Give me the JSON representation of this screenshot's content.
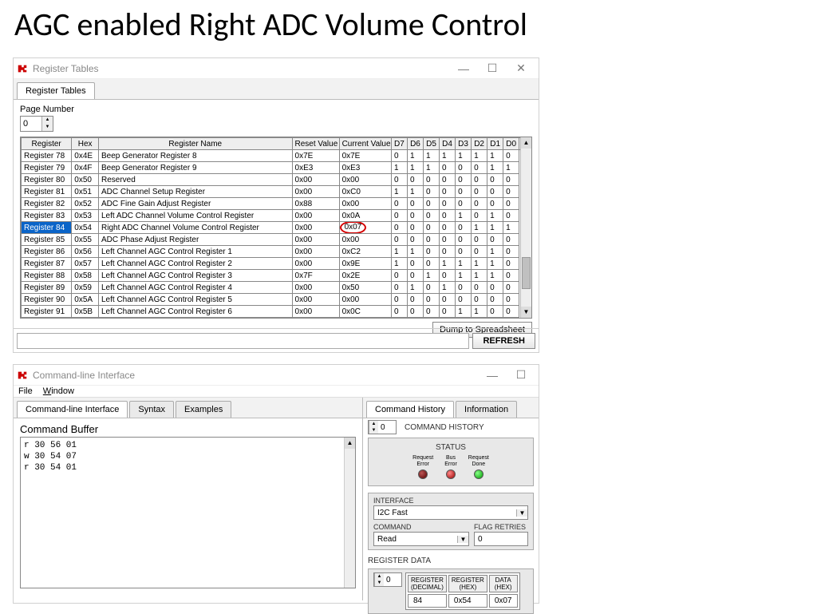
{
  "slide_title": "AGC enabled Right ADC Volume Control",
  "win1": {
    "title": "Register Tables",
    "tab": "Register Tables",
    "page_label": "Page Number",
    "page_value": "0",
    "headers": [
      "Register",
      "Hex",
      "Register Name",
      "Reset Value",
      "Current Value",
      "D7",
      "D6",
      "D5",
      "D4",
      "D3",
      "D2",
      "D1",
      "D0"
    ],
    "rows": [
      {
        "r": "Register 78",
        "h": "0x4E",
        "n": "Beep Generator Register 8",
        "rv": "0x7E",
        "cv": "0x7E",
        "b": [
          "0",
          "1",
          "1",
          "1",
          "1",
          "1",
          "1",
          "0"
        ]
      },
      {
        "r": "Register 79",
        "h": "0x4F",
        "n": "Beep Generator Register 9",
        "rv": "0xE3",
        "cv": "0xE3",
        "b": [
          "1",
          "1",
          "1",
          "0",
          "0",
          "0",
          "1",
          "1"
        ]
      },
      {
        "r": "Register 80",
        "h": "0x50",
        "n": "Reserved",
        "rv": "0x00",
        "cv": "0x00",
        "b": [
          "0",
          "0",
          "0",
          "0",
          "0",
          "0",
          "0",
          "0"
        ]
      },
      {
        "r": "Register 81",
        "h": "0x51",
        "n": "ADC Channel Setup Register",
        "rv": "0x00",
        "cv": "0xC0",
        "b": [
          "1",
          "1",
          "0",
          "0",
          "0",
          "0",
          "0",
          "0"
        ]
      },
      {
        "r": "Register 82",
        "h": "0x52",
        "n": "ADC Fine Gain Adjust Register",
        "rv": "0x88",
        "cv": "0x00",
        "b": [
          "0",
          "0",
          "0",
          "0",
          "0",
          "0",
          "0",
          "0"
        ]
      },
      {
        "r": "Register 83",
        "h": "0x53",
        "n": "Left ADC Channel Volume Control Register",
        "rv": "0x00",
        "cv": "0x0A",
        "b": [
          "0",
          "0",
          "0",
          "0",
          "1",
          "0",
          "1",
          "0"
        ]
      },
      {
        "r": "Register 84",
        "h": "0x54",
        "n": "Right ADC Channel Volume Control Register",
        "rv": "0x00",
        "cv": "0x07",
        "b": [
          "0",
          "0",
          "0",
          "0",
          "0",
          "1",
          "1",
          "1"
        ],
        "sel": true,
        "circle": true
      },
      {
        "r": "Register 85",
        "h": "0x55",
        "n": "ADC Phase Adjust Register",
        "rv": "0x00",
        "cv": "0x00",
        "b": [
          "0",
          "0",
          "0",
          "0",
          "0",
          "0",
          "0",
          "0"
        ]
      },
      {
        "r": "Register 86",
        "h": "0x56",
        "n": "Left Channel AGC Control Register 1",
        "rv": "0x00",
        "cv": "0xC2",
        "b": [
          "1",
          "1",
          "0",
          "0",
          "0",
          "0",
          "1",
          "0"
        ]
      },
      {
        "r": "Register 87",
        "h": "0x57",
        "n": "Left Channel AGC Control Register 2",
        "rv": "0x00",
        "cv": "0x9E",
        "b": [
          "1",
          "0",
          "0",
          "1",
          "1",
          "1",
          "1",
          "0"
        ]
      },
      {
        "r": "Register 88",
        "h": "0x58",
        "n": "Left Channel AGC Control Register 3",
        "rv": "0x7F",
        "cv": "0x2E",
        "b": [
          "0",
          "0",
          "1",
          "0",
          "1",
          "1",
          "1",
          "0"
        ]
      },
      {
        "r": "Register 89",
        "h": "0x59",
        "n": "Left Channel AGC Control Register 4",
        "rv": "0x00",
        "cv": "0x50",
        "b": [
          "0",
          "1",
          "0",
          "1",
          "0",
          "0",
          "0",
          "0"
        ]
      },
      {
        "r": "Register 90",
        "h": "0x5A",
        "n": "Left Channel AGC Control Register 5",
        "rv": "0x00",
        "cv": "0x00",
        "b": [
          "0",
          "0",
          "0",
          "0",
          "0",
          "0",
          "0",
          "0"
        ]
      },
      {
        "r": "Register 91",
        "h": "0x5B",
        "n": "Left Channel AGC Control Register 6",
        "rv": "0x00",
        "cv": "0x0C",
        "b": [
          "0",
          "0",
          "0",
          "0",
          "1",
          "1",
          "0",
          "0"
        ]
      }
    ],
    "dump_btn": "Dump to Spreadsheet",
    "refresh_btn": "REFRESH"
  },
  "win2": {
    "title": "Command-line Interface",
    "menu": {
      "file": "File",
      "window": "Window"
    },
    "tabs_left": [
      "Command-line Interface",
      "Syntax",
      "Examples"
    ],
    "tabs_right": [
      "Command History",
      "Information"
    ],
    "cmdbuf_label": "Command Buffer",
    "cmdbuf_text": "r 30 56 01\nw 30 54 07\nr 30 54 01",
    "history_label": "COMMAND HISTORY",
    "history_idx": "0",
    "status_label": "STATUS",
    "leds": [
      {
        "t1": "Request",
        "t2": "Error",
        "cls": "dark"
      },
      {
        "t1": "Bus",
        "t2": "Error",
        "cls": "red"
      },
      {
        "t1": "Request",
        "t2": "Done",
        "cls": "green"
      }
    ],
    "interface_label": "INTERFACE",
    "interface_val": "I2C Fast",
    "command_label": "COMMAND",
    "command_val": "Read",
    "retries_label": "FLAG RETRIES",
    "retries_val": "0",
    "regdata_label": "REGISTER DATA",
    "regdata_idx": "0",
    "rd_headers": [
      "REGISTER\n(DECIMAL)",
      "REGISTER\n(HEX)",
      "DATA\n(HEX)"
    ],
    "rd_row": [
      "84",
      "0x54",
      "0x07"
    ]
  }
}
